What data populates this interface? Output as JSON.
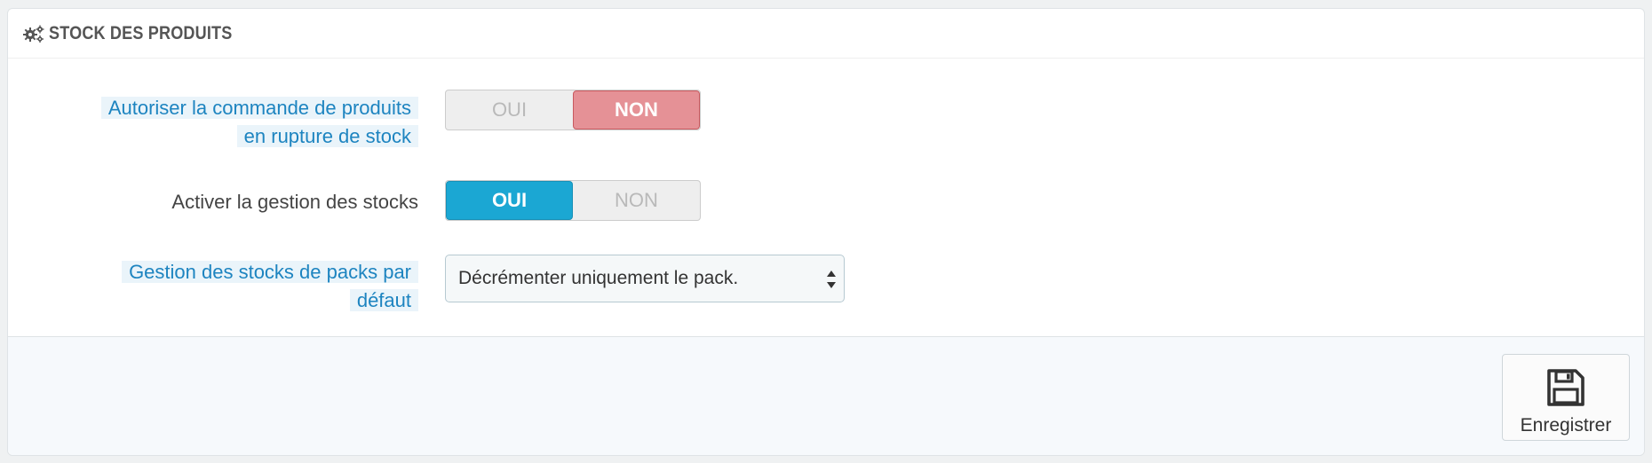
{
  "panel": {
    "title": "STOCK DES PRODUITS",
    "icon": "gears-icon"
  },
  "fields": {
    "allow_oos": {
      "label_line1": "Autoriser la commande de produits",
      "label_line2": "en rupture de stock",
      "yes_label": "OUI",
      "no_label": "NON",
      "value": "NON"
    },
    "stock_management": {
      "label": "Activer la gestion des stocks",
      "yes_label": "OUI",
      "no_label": "NON",
      "value": "OUI"
    },
    "pack_stock": {
      "label_line1": "Gestion des stocks de packs par",
      "label_line2": "défaut",
      "selected": "Décrémenter uniquement le pack."
    }
  },
  "footer": {
    "save_label": "Enregistrer",
    "save_icon": "floppy-disk-icon"
  },
  "colors": {
    "no_active": "#e59196",
    "yes_active": "#1ba7d3",
    "help_label": "#1d84c0",
    "help_bg": "#eaf4fa"
  }
}
